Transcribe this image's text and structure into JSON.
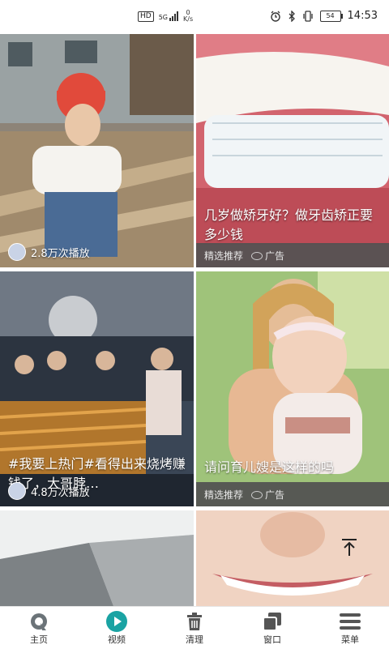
{
  "status_bar": {
    "hd_label": "HD",
    "network_type": "5G",
    "net_speed_value": "0",
    "net_speed_unit": "K/s",
    "battery": "54",
    "time": "14:53"
  },
  "feed": {
    "cards": [
      {
        "title": "",
        "play_count": "2.8万次播放",
        "kind": "video"
      },
      {
        "title": "几岁做矫牙好？做牙齿矫正要多少钱",
        "ad_source": "精选推荐",
        "ad_label": "广告",
        "kind": "ad"
      },
      {
        "title": "#我要上热门#看得出来烧烤赚钱了，大哥脖…",
        "play_count": "4.8万次播放",
        "kind": "video"
      },
      {
        "title": "请问育儿嫂是这样的吗",
        "ad_source": "精选推荐",
        "ad_label": "广告",
        "kind": "ad"
      },
      {
        "title": "",
        "kind": "video"
      },
      {
        "title": "",
        "kind": "video"
      }
    ]
  },
  "scroll_top_icon": "arrow-up-icon",
  "bottom_nav": {
    "items": [
      {
        "label": "主页",
        "icon": "home-icon"
      },
      {
        "label": "视频",
        "icon": "play-icon",
        "active_color": "#1aa3a3"
      },
      {
        "label": "清理",
        "icon": "trash-icon"
      },
      {
        "label": "窗口",
        "icon": "windows-icon"
      },
      {
        "label": "菜单",
        "icon": "menu-icon"
      }
    ]
  }
}
